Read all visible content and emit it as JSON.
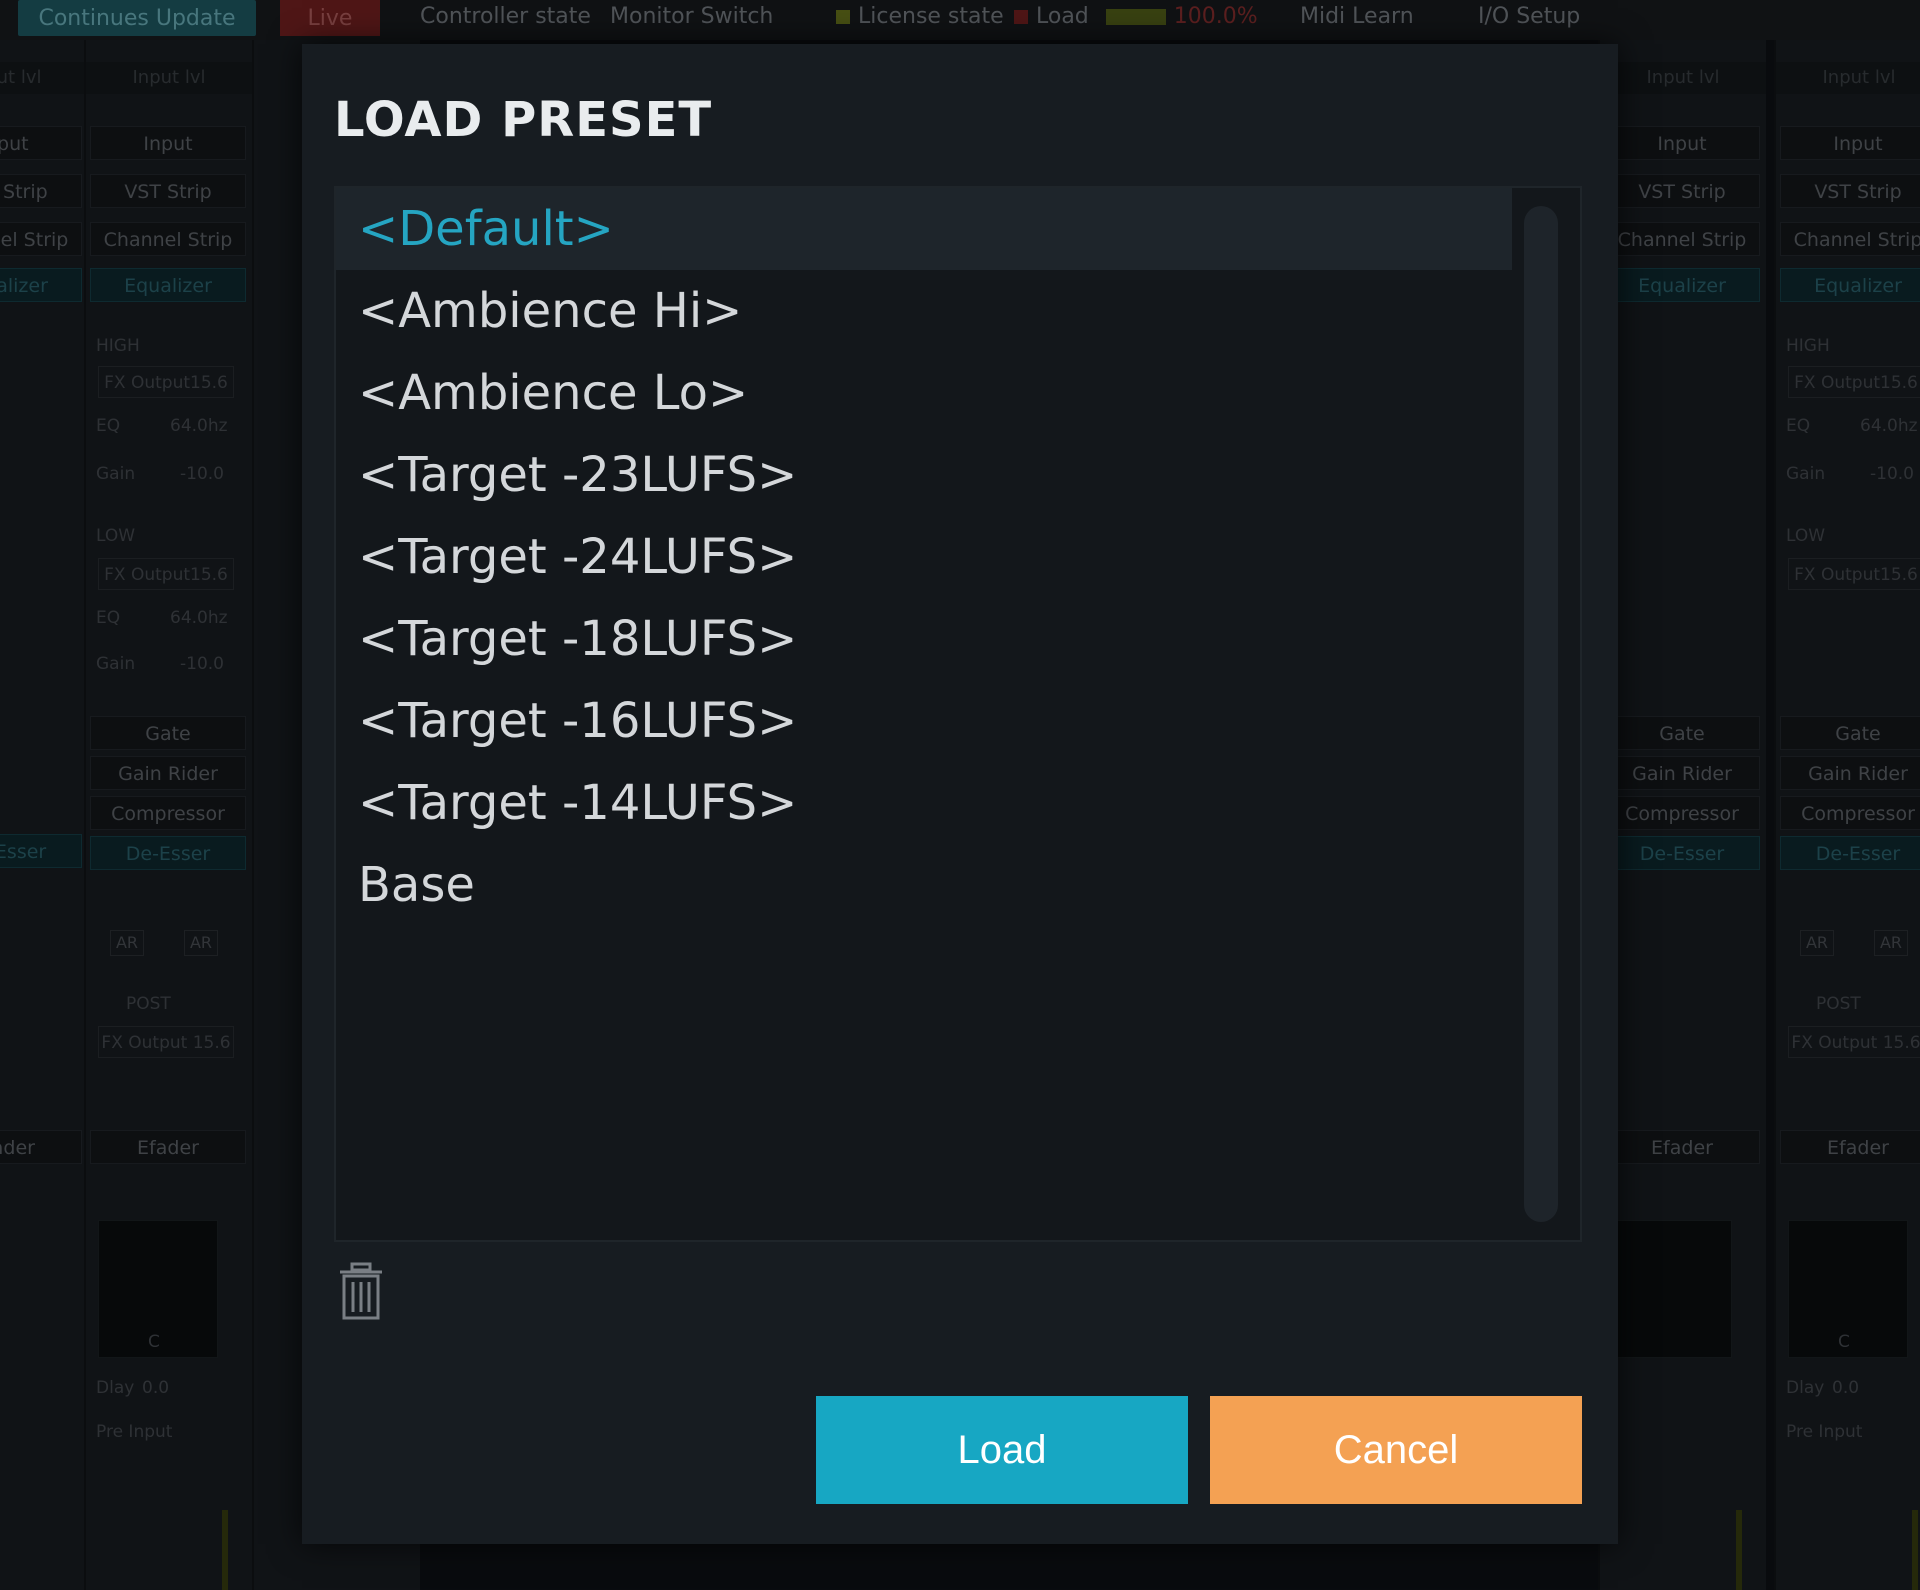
{
  "topbar": {
    "continues_update": "Continues Update",
    "live": "Live",
    "controller_state": "Controller state",
    "monitor_switch": "Monitor Switch",
    "license_state": "License state",
    "load_label": "Load",
    "load_percent": "100.0%",
    "midi_learn": "Midi Learn",
    "io_setup": "I/O Setup"
  },
  "strip": {
    "input_level": "Input lvl",
    "input": "Input",
    "vst_strip": "VST Strip",
    "channel_strip": "Channel Strip",
    "equalizer": "Equalizer",
    "high": "HIGH",
    "low": "LOW",
    "fx_output": "FX Output15.6",
    "eq": "EQ",
    "freq": "64.0hz",
    "gain": "Gain",
    "gain_value": "-10.0",
    "gate": "Gate",
    "gain_rider": "Gain Rider",
    "compressor": "Compressor",
    "de_esser": "De-Esser",
    "ar": "AR",
    "post": "POST",
    "fx_output_2": "FX Output 15.6",
    "efader": "Efader",
    "pan_c": "C",
    "dlay": "Dlay",
    "dlay_value": "0.0",
    "pre_input": "Pre Input"
  },
  "modal": {
    "title": "LOAD PRESET",
    "presets": [
      "<Default>",
      "<Ambience Hi>",
      "<Ambience Lo>",
      "<Target -23LUFS>",
      "<Target -24LUFS>",
      "<Target -18LUFS>",
      "<Target -16LUFS>",
      "<Target -14LUFS>",
      "Base"
    ],
    "selected_index": 0,
    "load_label": "Load",
    "cancel_label": "Cancel"
  },
  "colors": {
    "accent": "#17a7c3",
    "selected_text": "#25a5c2",
    "cancel": "#f4a153"
  }
}
